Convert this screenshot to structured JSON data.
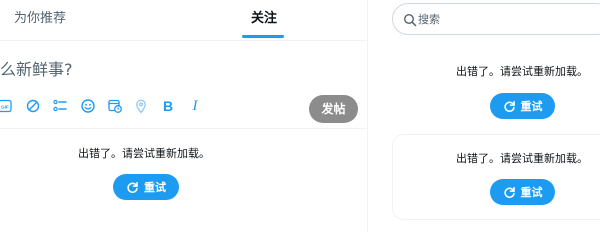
{
  "tabs": [
    {
      "label": "为你推荐"
    },
    {
      "label": "关注"
    }
  ],
  "compose": {
    "placeholder": "么新鲜事?",
    "toolbar": {
      "gif_label": "GIF",
      "bold_label": "B",
      "italic_label": "I",
      "icons": [
        "gif-icon",
        "no-entry-icon",
        "list-icon",
        "emoji-icon",
        "schedule-icon",
        "location-icon",
        "bold-icon",
        "italic-icon"
      ]
    },
    "post_label": "发帖"
  },
  "feed_error": {
    "message": "出错了。请尝试重新加载。",
    "retry_label": "重试"
  },
  "sidebar": {
    "search_placeholder": "搜索",
    "error_1": {
      "message": "出错了。请尝试重新加载。",
      "retry_label": "重试"
    },
    "error_2": {
      "message": "出错了。请尝试重新加载。",
      "retry_label": "重试"
    }
  },
  "colors": {
    "accent": "#1d9bf0",
    "post_button_disabled": "#8c8c8c",
    "secondary_text": "#536471",
    "border": "#eff3f4"
  }
}
